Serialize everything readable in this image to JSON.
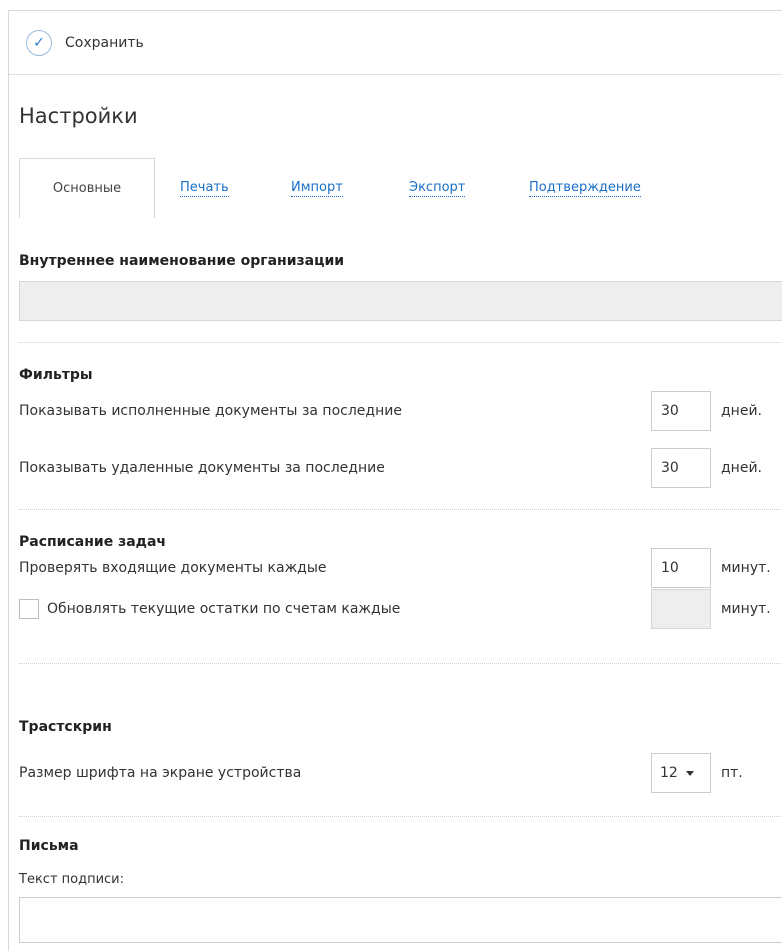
{
  "toolbar": {
    "save_label": "Сохранить",
    "save_icon": "check-circle-icon"
  },
  "page": {
    "title": "Настройки"
  },
  "tabs": [
    {
      "label": "Основные",
      "active": true
    },
    {
      "label": "Печать",
      "active": false
    },
    {
      "label": "Импорт",
      "active": false
    },
    {
      "label": "Экспорт",
      "active": false
    },
    {
      "label": "Подтверждение",
      "active": false
    }
  ],
  "org": {
    "label": "Внутреннее наименование организации",
    "value": ""
  },
  "filters": {
    "title": "Фильтры",
    "executed": {
      "label": "Показывать исполненные документы за последние",
      "value": "30",
      "unit": "дней."
    },
    "deleted": {
      "label": "Показывать удаленные документы за последние",
      "value": "30",
      "unit": "дней."
    }
  },
  "schedule": {
    "title": "Расписание задач",
    "incoming": {
      "label": "Проверять входящие документы каждые",
      "value": "10",
      "unit": "минут."
    },
    "balances": {
      "label": "Обновлять текущие остатки по счетам каждые",
      "checked": false,
      "value": "",
      "unit": "минут."
    }
  },
  "trustscreen": {
    "title": "Трастскрин",
    "font_size": {
      "label": "Размер шрифта на экране устройства",
      "value": "12",
      "unit": "пт."
    }
  },
  "letters": {
    "title": "Письма",
    "signature_label": "Текст подписи:",
    "signature_value": ""
  },
  "colors": {
    "link": "#1a6fc7",
    "border": "#d9d9d9",
    "disabled_bg": "#eeeeee"
  }
}
